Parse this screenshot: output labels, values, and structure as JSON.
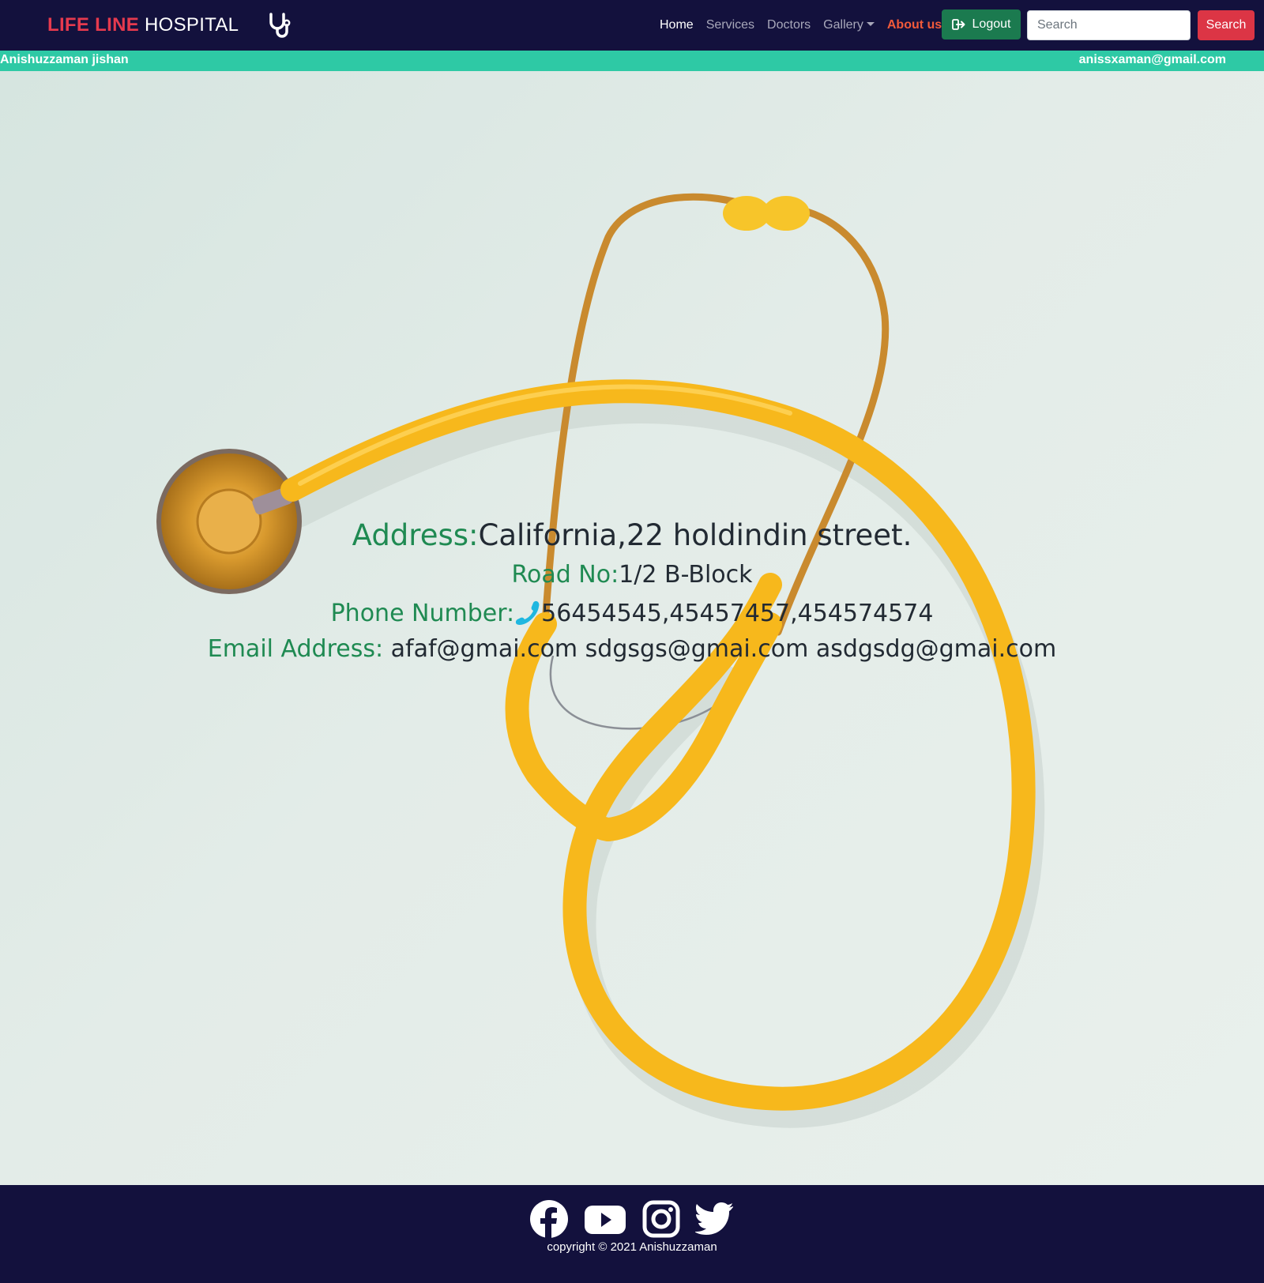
{
  "navbar": {
    "brand_red": "LIFE LINE",
    "brand_white": "HOSPITAL",
    "links": [
      {
        "label": "Home"
      },
      {
        "label": "Services"
      },
      {
        "label": "Doctors"
      },
      {
        "label": "Gallery"
      },
      {
        "label": "About us"
      }
    ],
    "logout_label": "Logout",
    "search_placeholder": "Search",
    "search_button": "Search"
  },
  "infobar": {
    "user_name": "Anishuzzaman jishan",
    "user_email": "anissxaman@gmail.com"
  },
  "contact": {
    "address_label": "Address:",
    "address_value": "California,22 holdindin street.",
    "road_label": "Road No:",
    "road_value": "1/2 B-Block",
    "phone_label": "Phone Number:",
    "phone_value": "56454545,45457457,454574574",
    "email_label": "Email Address:",
    "email_value": "afaf@gmai.com sdgsgs@gmai.com asdgsdg@gmai.com"
  },
  "footer": {
    "social_icons": [
      "facebook-icon",
      "youtube-icon",
      "instagram-icon",
      "twitter-icon"
    ],
    "copyright": "copyright © 2021 Anishuzzaman"
  },
  "colors": {
    "navbar_bg": "#13113d",
    "infobar_bg": "#2ec9a5",
    "brand_red": "#e63a4e",
    "about_link": "#f15a3a",
    "logout_bg": "#1b7a4f",
    "search_btn_bg": "#dc3545",
    "label_green": "#1f8a52",
    "stethoscope_yellow": "#f7b81c"
  }
}
